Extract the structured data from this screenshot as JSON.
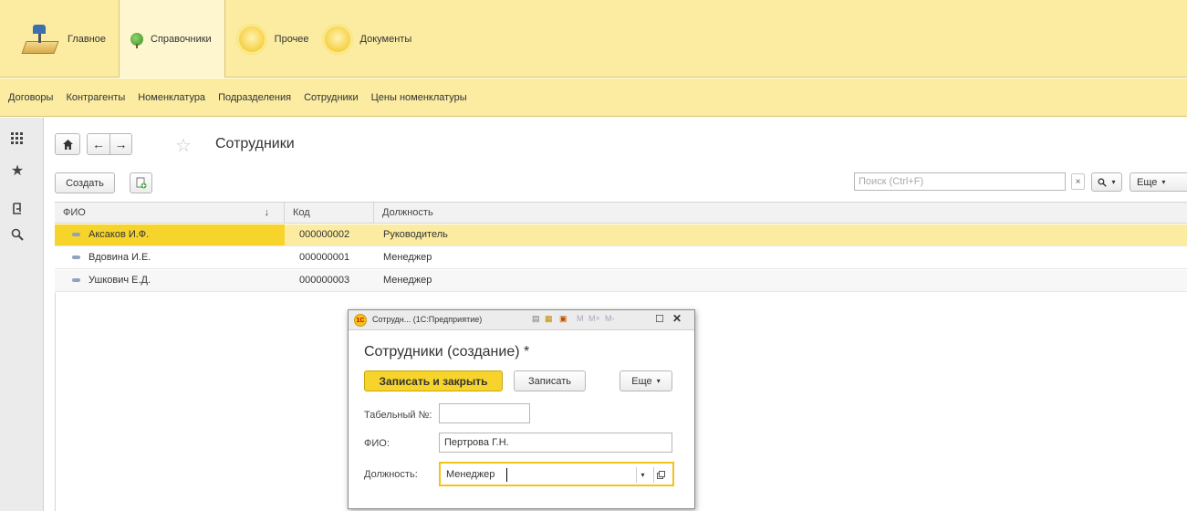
{
  "sections": [
    {
      "label": "Главное",
      "icon": "desk-lamp-icon"
    },
    {
      "label": "Справочники",
      "icon": "tree-icon",
      "active": true
    },
    {
      "label": "Прочее",
      "icon": "yellow-disc-icon"
    },
    {
      "label": "Документы",
      "icon": "yellow-disc-icon"
    }
  ],
  "subnav": [
    "Договоры",
    "Контрагенты",
    "Номенклатура",
    "Подразделения",
    "Сотрудники",
    "Цены номенклатуры"
  ],
  "page": {
    "title": "Сотрудники",
    "create_label": "Создать",
    "search_placeholder": "Поиск (Ctrl+F)",
    "search_clear": "×",
    "more_label": "Еще"
  },
  "table": {
    "columns": [
      "ФИО",
      "Код",
      "Должность"
    ],
    "sort_indicator": "↓",
    "rows": [
      {
        "fio": "Аксаков И.Ф.",
        "code": "000000002",
        "position": "Руководитель",
        "selected": true
      },
      {
        "fio": "Вдовина И.Е.",
        "code": "000000001",
        "position": "Менеджер"
      },
      {
        "fio": "Ушкович Е.Д.",
        "code": "000000003",
        "position": "Менеджер"
      }
    ]
  },
  "modal": {
    "window_title": "Сотрудн... (1С:Предприятие)",
    "toolbar_m": "M",
    "toolbar_mplus": "M+",
    "toolbar_mminus": "M-",
    "title": "Сотрудники (создание) *",
    "save_close_label": "Записать и закрыть",
    "save_label": "Записать",
    "more_label": "Еще",
    "fields": {
      "tab_number_label": "Табельный №:",
      "tab_number_value": "",
      "fio_label": "ФИО:",
      "fio_value": "Пертрова Г.Н.",
      "position_label": "Должность:",
      "position_value": "Менеджер"
    }
  },
  "colors": {
    "accent_yellow": "#f7d42b",
    "panel_yellow": "#fbeca2"
  }
}
